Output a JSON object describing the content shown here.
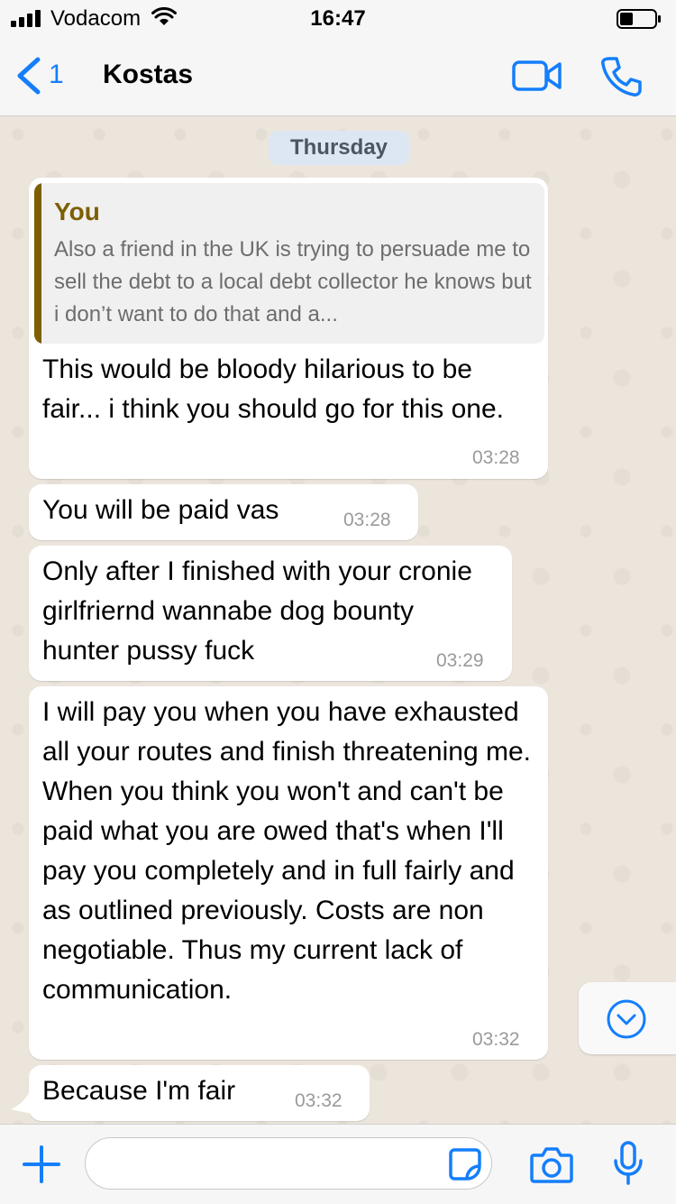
{
  "status_bar": {
    "carrier": "Vodacom",
    "time": "16:47"
  },
  "nav": {
    "back_count": "1",
    "contact_name": "Kostas"
  },
  "chat": {
    "day_label": "Thursday",
    "messages": [
      {
        "quote": {
          "author": "You",
          "text": "Also a friend in the UK is trying to persuade me to sell the debt to a local debt collector he knows but i don’t want to do that and a..."
        },
        "text": "This would be bloody hilarious to be fair... i think you should go for this one.",
        "time": "03:28"
      },
      {
        "text": "You will be paid vas",
        "time": "03:28"
      },
      {
        "text": "Only after I finished with your cronie girlfriernd wannabe dog bounty hunter pussy fuck",
        "time": "03:29"
      },
      {
        "text": "I will pay you when you have exhausted all your routes and finish threatening me. When you think you won't and can't be paid what you are owed that's when I'll pay you completely and in full fairly and as outlined previously. Costs are non negotiable. Thus my current lack of communication.",
        "time": "03:32"
      },
      {
        "text": "Because I'm fair",
        "time": "03:32"
      }
    ]
  },
  "colors": {
    "accent": "#147efb",
    "quote_bar": "#7d5f00",
    "chat_background": "#ece5dc",
    "day_badge": "#dde7f4"
  },
  "icons": {
    "back": "chevron-left-icon",
    "video": "video-camera-icon",
    "call": "phone-icon",
    "scroll": "chevron-down-circle-icon",
    "attach": "plus-icon",
    "sticker": "sticker-icon",
    "camera": "camera-icon",
    "mic": "microphone-icon"
  }
}
